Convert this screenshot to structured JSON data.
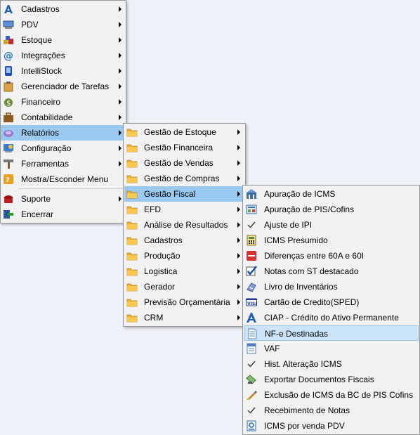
{
  "main_menu": {
    "items": [
      {
        "label": "Cadastros",
        "icon": "cadastros-icon",
        "submenu": true
      },
      {
        "label": "PDV",
        "icon": "pdv-icon",
        "submenu": true
      },
      {
        "label": "Estoque",
        "icon": "estoque-icon",
        "submenu": true
      },
      {
        "label": "Integrações",
        "icon": "integracoes-icon",
        "submenu": true
      },
      {
        "label": "IntelliStock",
        "icon": "intellistock-icon",
        "submenu": true
      },
      {
        "label": "Gerenciador de Tarefas",
        "icon": "tarefas-icon",
        "submenu": true
      },
      {
        "label": "Financeiro",
        "icon": "financeiro-icon",
        "submenu": true
      },
      {
        "label": "Contabilidade",
        "icon": "contabilidade-icon",
        "submenu": true
      },
      {
        "label": "Relatórios",
        "icon": "relatorios-icon",
        "submenu": true,
        "highlighted": true
      },
      {
        "label": "Configuração",
        "icon": "configuracao-icon",
        "submenu": true
      },
      {
        "label": "Ferramentas",
        "icon": "ferramentas-icon",
        "submenu": true
      },
      {
        "label": "Mostra/Esconder Menu",
        "icon": "mostra-esconder-icon",
        "submenu": false
      },
      {
        "label": "Suporte",
        "icon": "suporte-icon",
        "submenu": true
      },
      {
        "label": "Encerrar",
        "icon": "encerrar-icon",
        "submenu": false
      }
    ]
  },
  "relatorios_menu": {
    "items": [
      {
        "label": "Gestão de Estoque",
        "icon": "folder-icon"
      },
      {
        "label": "Gestão Financeira",
        "icon": "folder-icon"
      },
      {
        "label": "Gestão de Vendas",
        "icon": "folder-icon"
      },
      {
        "label": "Gestão de Compras",
        "icon": "folder-icon"
      },
      {
        "label": "Gestão Fiscal",
        "icon": "folder-icon",
        "highlighted": true
      },
      {
        "label": "EFD",
        "icon": "folder-icon"
      },
      {
        "label": "Análise de Resultados",
        "icon": "folder-icon"
      },
      {
        "label": "Cadastros",
        "icon": "folder-icon"
      },
      {
        "label": "Produção",
        "icon": "folder-icon"
      },
      {
        "label": "Logistica",
        "icon": "folder-icon"
      },
      {
        "label": "Gerador",
        "icon": "folder-icon"
      },
      {
        "label": "Previsão Orçamentária",
        "icon": "folder-icon"
      },
      {
        "label": "CRM",
        "icon": "folder-icon"
      }
    ]
  },
  "fiscal_menu": {
    "items": [
      {
        "label": "Apuração de ICMS",
        "icon": "apuracao-icms-icon"
      },
      {
        "label": "Apuração de PIS/Cofins",
        "icon": "apuracao-pis-icon"
      },
      {
        "label": "Ajuste de IPI",
        "icon": "check-icon"
      },
      {
        "label": "ICMS Presumido",
        "icon": "calculator-icon"
      },
      {
        "label": "Diferenças entre 60A e 60I",
        "icon": "minus-red-icon"
      },
      {
        "label": "Notas com ST destacado",
        "icon": "checkbox-icon"
      },
      {
        "label": "Livro de Inventários",
        "icon": "livro-icon"
      },
      {
        "label": "Cartão de Credito(SPED)",
        "icon": "visa-card-icon"
      },
      {
        "label": "CIAP - Crédito do Ativo Permanente",
        "icon": "ciap-icon"
      },
      {
        "label": "NF-e Destinadas",
        "icon": "document-icon",
        "highlighted": true
      },
      {
        "label": "VAF",
        "icon": "vaf-icon"
      },
      {
        "label": "Hist. Alteração ICMS",
        "icon": "check-icon"
      },
      {
        "label": "Exportar Documentos Fiscais",
        "icon": "exportar-icon"
      },
      {
        "label": "Exclusão de ICMS da BC de PIS Cofins",
        "icon": "exclusao-icon"
      },
      {
        "label": "Recebimento de Notas",
        "icon": "check-icon"
      },
      {
        "label": "ICMS por venda PDV",
        "icon": "icms-pdv-icon"
      }
    ]
  },
  "colors": {
    "menu_bg": "#f2f2f2",
    "highlight": "#99c9ef",
    "highlight_light": "#cce4f7",
    "desktop_bg": "#eef1f7"
  }
}
